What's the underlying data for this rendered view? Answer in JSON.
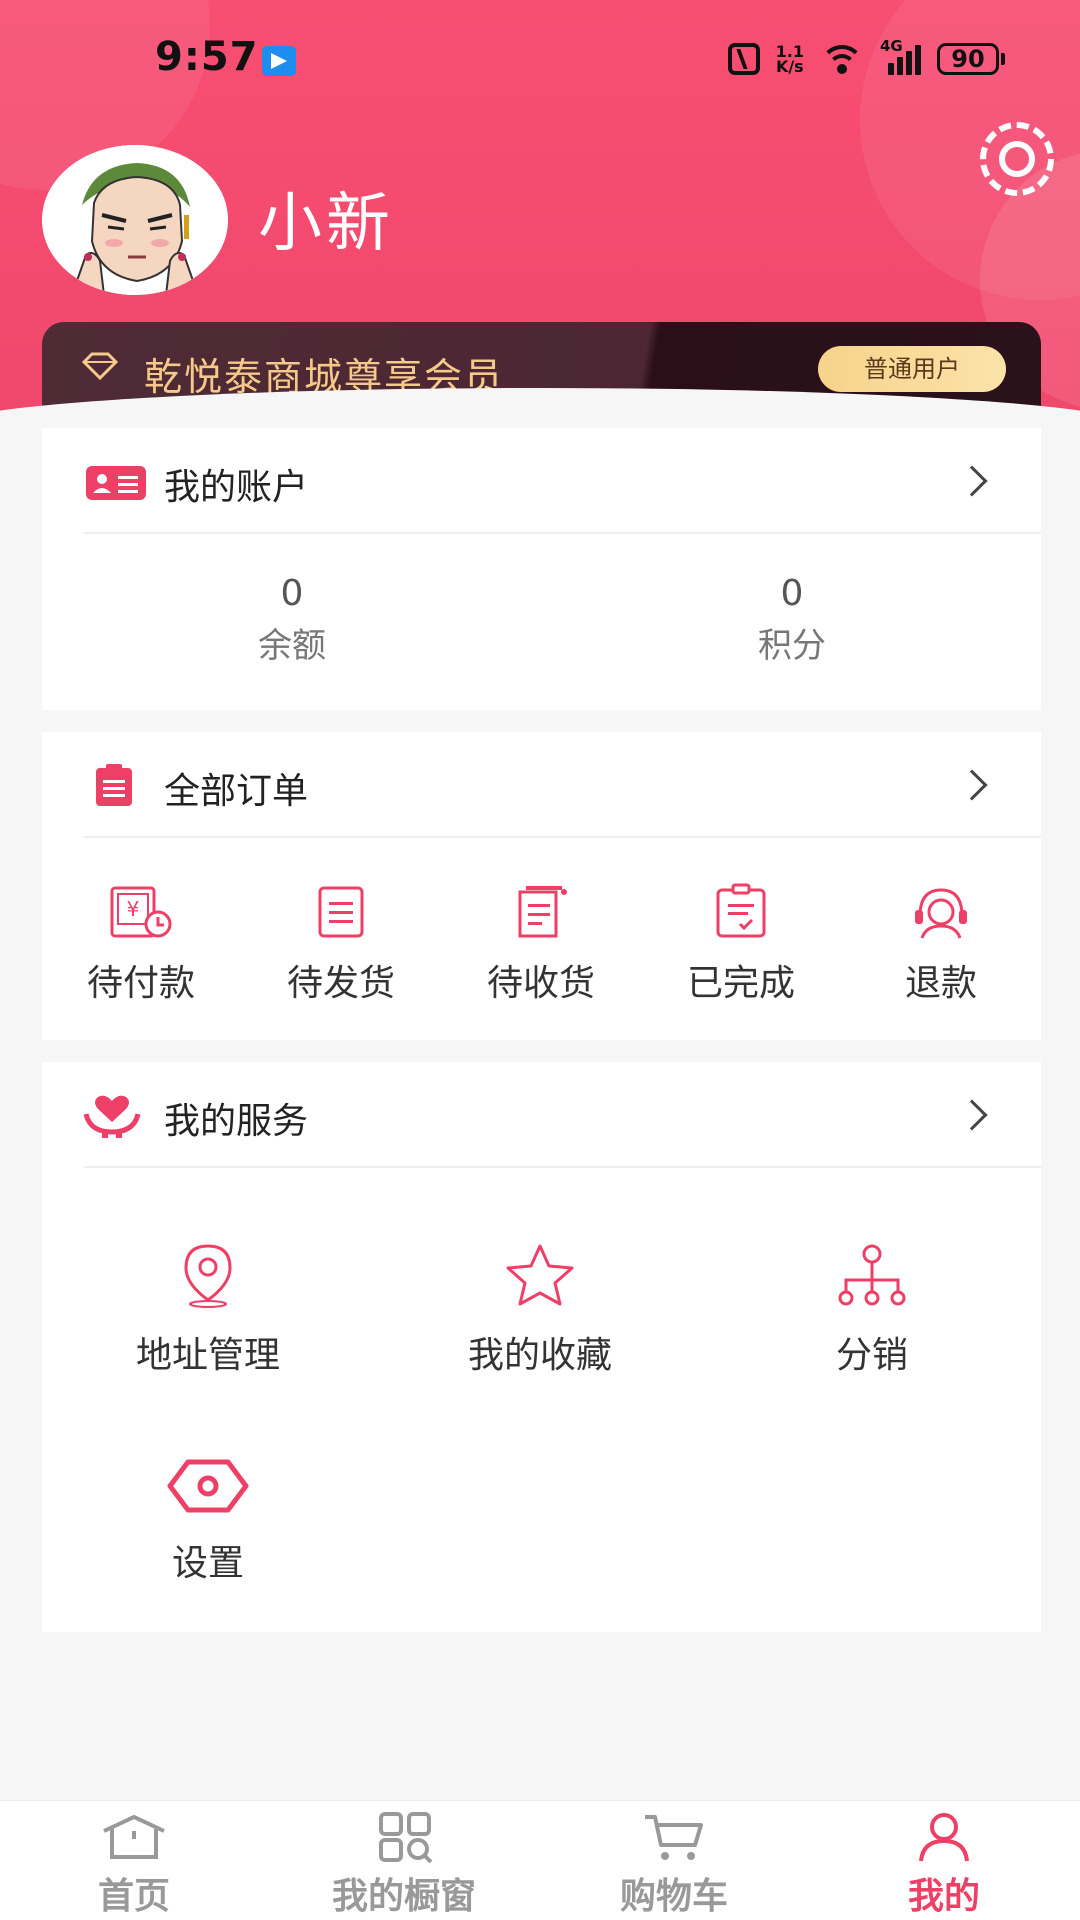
{
  "status_bar": {
    "time": "9:57",
    "net_speed_top": "1.1",
    "net_speed_bottom": "K/s",
    "network_type": "4G",
    "battery": "90"
  },
  "profile": {
    "username": "小新"
  },
  "vip": {
    "title": "乾悦泰商城尊享会员",
    "badge": "普通用户"
  },
  "account": {
    "title": "我的账户",
    "balance_value": "0",
    "balance_label": "余额",
    "points_value": "0",
    "points_label": "积分"
  },
  "orders": {
    "title": "全部订单",
    "items": [
      {
        "label": "待付款",
        "icon": "pending-payment-icon"
      },
      {
        "label": "待发货",
        "icon": "pending-shipment-icon"
      },
      {
        "label": "待收货",
        "icon": "pending-receipt-icon"
      },
      {
        "label": "已完成",
        "icon": "completed-icon"
      },
      {
        "label": "退款",
        "icon": "refund-icon"
      }
    ]
  },
  "services": {
    "title": "我的服务",
    "items": [
      {
        "label": "地址管理",
        "icon": "location-pin-icon"
      },
      {
        "label": "我的收藏",
        "icon": "star-icon"
      },
      {
        "label": "分销",
        "icon": "distribution-tree-icon"
      },
      {
        "label": "设置",
        "icon": "settings-hexagon-icon"
      }
    ]
  },
  "bottom_nav": {
    "items": [
      {
        "label": "首页",
        "icon": "home-icon"
      },
      {
        "label": "我的橱窗",
        "icon": "grid-icon"
      },
      {
        "label": "购物车",
        "icon": "cart-icon"
      },
      {
        "label": "我的",
        "icon": "user-icon",
        "active": true
      }
    ]
  },
  "colors": {
    "accent": "#ee3f66",
    "header": "#f74e72",
    "vip_gold": "#f5c98a"
  }
}
